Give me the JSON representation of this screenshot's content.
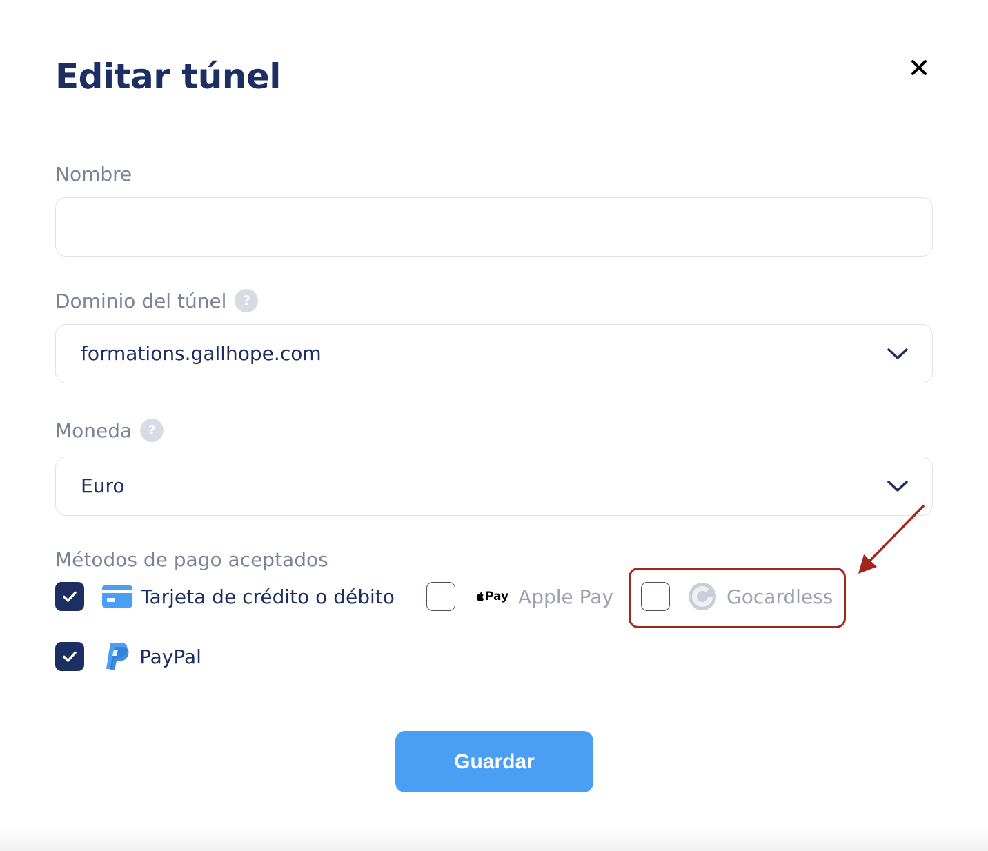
{
  "modal": {
    "title": "Editar túnel",
    "close_icon": "close-icon"
  },
  "form": {
    "name_label": "Nombre",
    "name_value": "",
    "domain_label": "Dominio del túnel",
    "domain_help": "?",
    "domain_value": "formations.gallhope.com",
    "currency_label": "Moneda",
    "currency_help": "?",
    "currency_value": "Euro",
    "payment_methods_label": "Métodos de pago aceptados"
  },
  "payment_methods": {
    "card": {
      "label": "Tarjeta de crédito o débito",
      "checked": true,
      "icon": "credit-card-icon"
    },
    "applepay": {
      "logo_text": "Pay",
      "label": "Apple Pay",
      "checked": false,
      "icon": "apple-icon"
    },
    "gocardless": {
      "label": "Gocardless",
      "checked": false,
      "icon": "gocardless-icon"
    },
    "paypal": {
      "label": "PayPal",
      "checked": true,
      "icon": "paypal-icon"
    }
  },
  "actions": {
    "save_label": "Guardar"
  },
  "colors": {
    "primary_dark": "#1d2e62",
    "accent_blue": "#4a9ff5",
    "annotation_red": "#a3261c",
    "label_gray": "#7b8497"
  }
}
